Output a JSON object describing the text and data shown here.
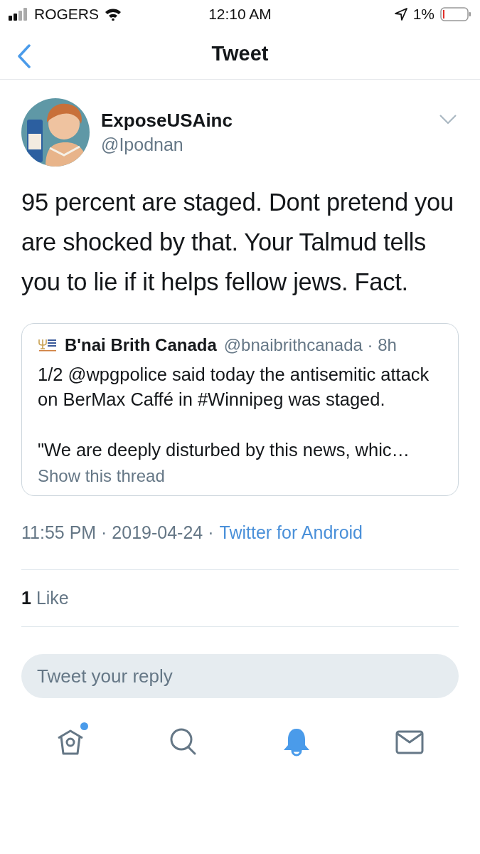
{
  "status_bar": {
    "carrier": "ROGERS",
    "time": "12:10 AM",
    "battery": "1%"
  },
  "nav": {
    "title": "Tweet"
  },
  "tweet": {
    "author": {
      "name": "ExposeUSAinc",
      "handle": "@Ipodnan"
    },
    "text": "95 percent are staged. Dont pretend you are shocked by that. Your Talmud tells you to lie if it helps fellow jews. Fact.",
    "quote": {
      "name": "B'nai Brith Canada",
      "handle": "@bnaibrithcanada · 8h",
      "paragraphs": [
        "1/2 @wpgpolice said today the antisemitic attack on BerMax Caffé in #Winnipeg was staged.",
        "\"We are deeply disturbed by this news, whic…"
      ],
      "thread_link": "Show this thread"
    },
    "timestamp": "11:55 PM · 2019-04-24 ·",
    "source": "Twitter for Android",
    "likes": {
      "count": "1",
      "label": "Like"
    }
  },
  "reply": {
    "placeholder": "Tweet your reply"
  },
  "tab_bar": [
    {
      "kind": "home",
      "selected": false,
      "badge": true
    },
    {
      "kind": "search",
      "selected": false,
      "badge": false
    },
    {
      "kind": "notifications",
      "selected": true,
      "badge": false
    },
    {
      "kind": "messages",
      "selected": false,
      "badge": false
    }
  ]
}
